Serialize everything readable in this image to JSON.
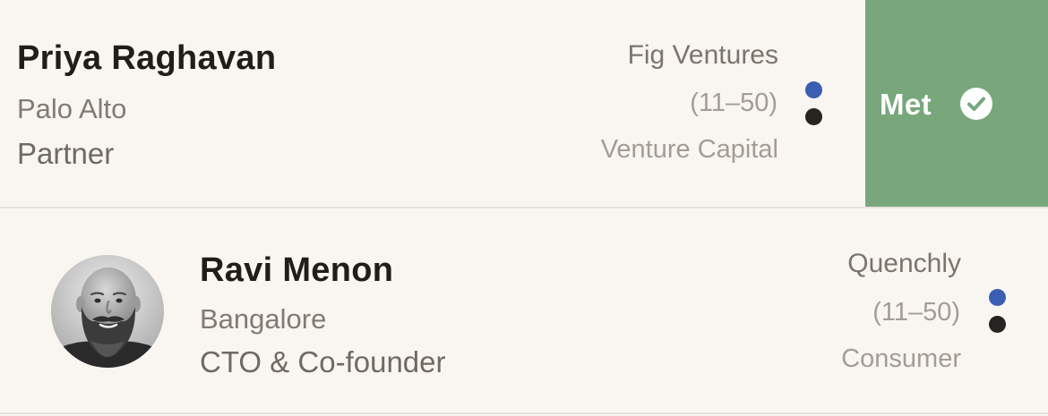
{
  "contacts": [
    {
      "name": "Priya Raghavan",
      "location": "Palo Alto",
      "title": "Partner",
      "company": "Fig Ventures",
      "size": "(11–50)",
      "industry": "Venture Capital",
      "status_colors": [
        "#3a5eb1",
        "#262320"
      ],
      "action": {
        "label": "Met",
        "icon": "check-circle-icon",
        "color": "#78a77c"
      }
    },
    {
      "name": "Ravi Menon",
      "location": "Bangalore",
      "title": "CTO & Co-founder",
      "company": "Quenchly",
      "size": "(11–50)",
      "industry": "Consumer",
      "avatar": "bearded-man-avatar",
      "status_colors": [
        "#3a5eb1",
        "#262320"
      ]
    }
  ]
}
